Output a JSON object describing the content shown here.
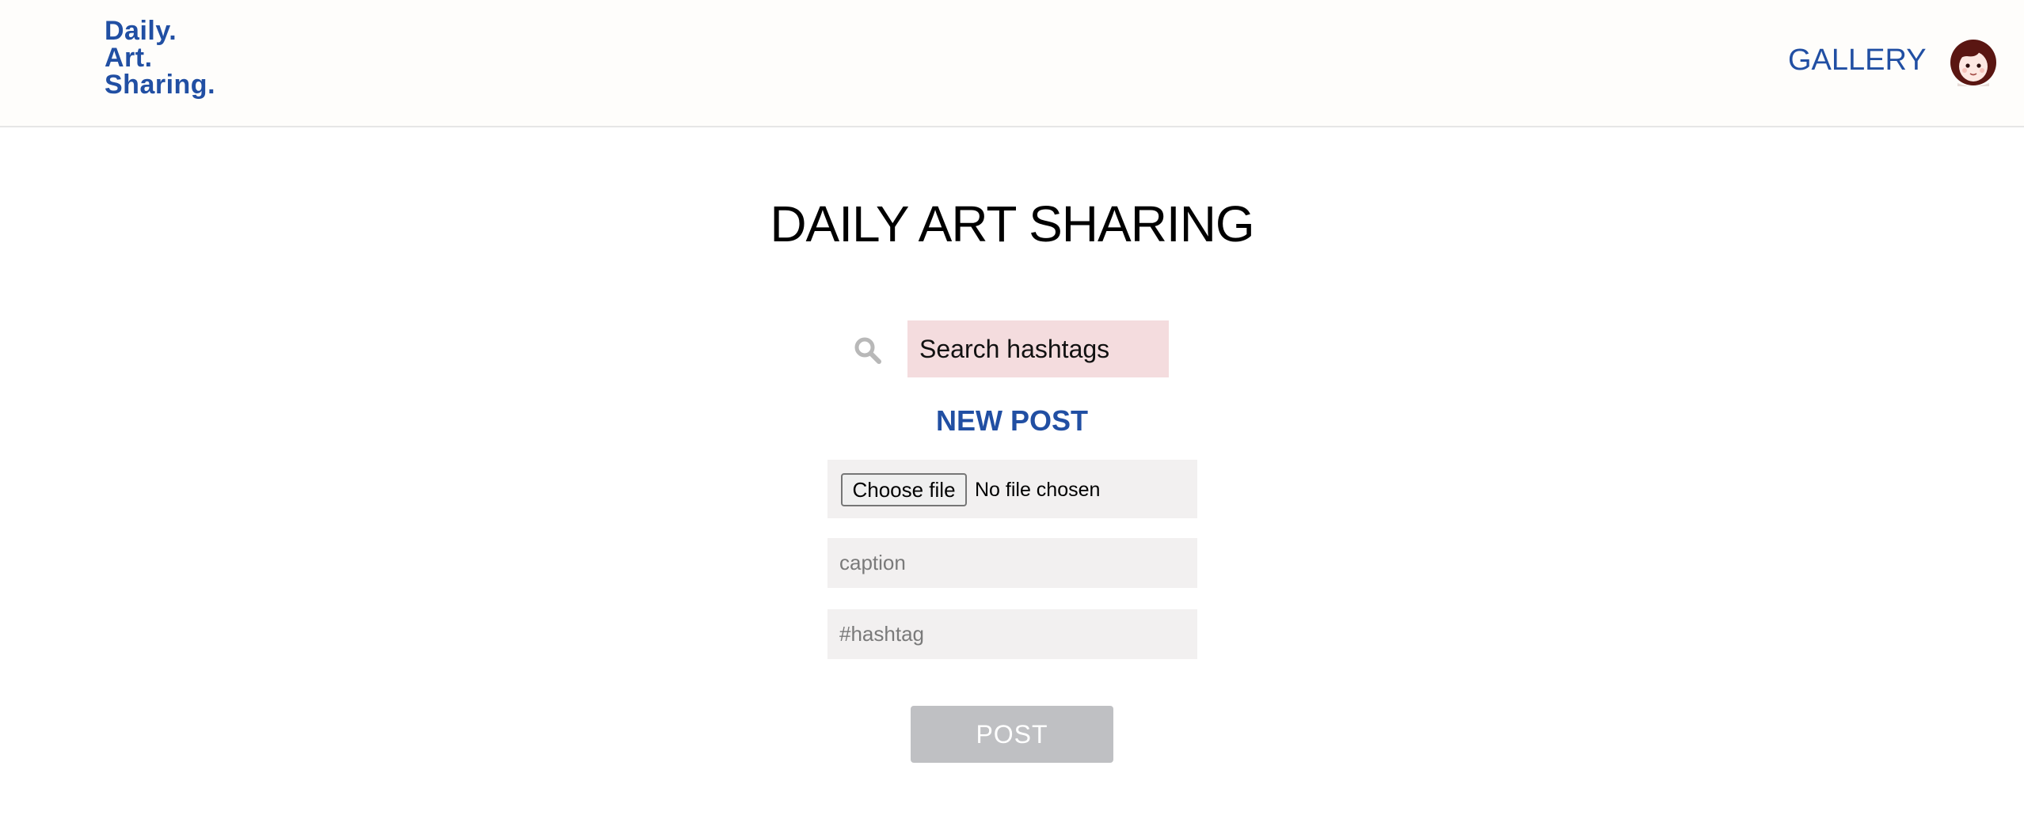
{
  "header": {
    "logo_lines": [
      "Daily.",
      "Art.",
      "Sharing."
    ],
    "nav_gallery": "GALLERY",
    "avatar_icon": "user-avatar-icon"
  },
  "main": {
    "title": "DAILY ART SHARING",
    "search": {
      "icon": "search-icon",
      "placeholder": "Search hashtags",
      "value": ""
    },
    "new_post": {
      "heading": "NEW POST",
      "file_button_label": "Choose file",
      "file_status": "No file chosen",
      "caption_placeholder": "caption",
      "caption_value": "",
      "hashtag_placeholder": "#hashtag",
      "hashtag_value": "",
      "post_button_label": "POST"
    }
  },
  "colors": {
    "brand_blue": "#214fa3",
    "search_bg": "#f4dcde",
    "field_bg": "#f2f0f0",
    "post_button_bg": "#bfc0c3",
    "header_bg": "#fefdfb"
  }
}
